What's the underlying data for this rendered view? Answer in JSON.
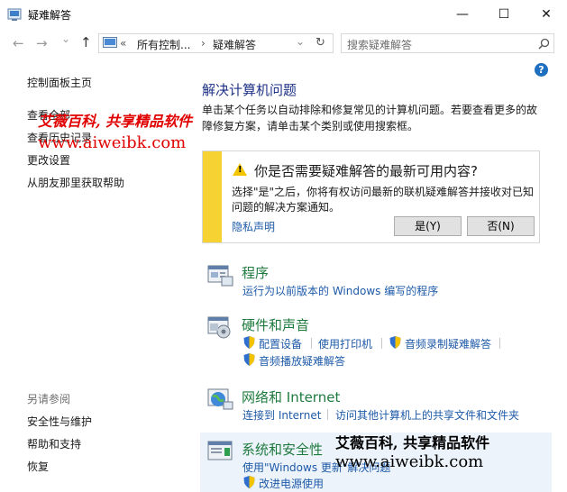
{
  "window": {
    "title": "疑难解答",
    "min": "—",
    "max": "☐",
    "close": "✕"
  },
  "nav": {
    "back": "←",
    "forward": "→",
    "dropdown": "⌄",
    "up": "↑",
    "chev": "«",
    "crumb1": "所有控制...",
    "crumb_sep": "›",
    "crumb2": "疑难解答",
    "refresh": "↻",
    "search_placeholder": "搜索疑难解答"
  },
  "help_icon": "?",
  "left": {
    "home": "控制面板主页",
    "view_all": "查看全部",
    "history": "查看历史记录",
    "settings": "更改设置",
    "friend": "从朋友那里获取帮助",
    "see_also": "另请参阅",
    "security": "安全性与维护",
    "help_support": "帮助和支持",
    "recovery": "恢复"
  },
  "main": {
    "heading": "解决计算机问题",
    "description": "单击某个任务以自动排除和修复常见的计算机问题。若要查看更多的故障修复方案，请单击某个类别或使用搜索框。",
    "notice": {
      "title": "你是否需要疑难解答的最新可用内容?",
      "text": "选择\"是\"之后，你将有权访问最新的联机疑难解答并接收对已知问题的解决方案通知。",
      "privacy": "隐私声明",
      "yes": "是(Y)",
      "no": "否(N)",
      "warn_glyph": "!"
    },
    "categories": [
      {
        "title": "程序",
        "links": [
          "运行为以前版本的 Windows 编写的程序"
        ]
      },
      {
        "title": "硬件和声音",
        "links": [
          "配置设备",
          "使用打印机",
          "音频录制疑难解答",
          "音频播放疑难解答"
        ]
      },
      {
        "title": "网络和 Internet",
        "links": [
          "连接到 Internet",
          "访问其他计算机上的共享文件和文件夹"
        ]
      },
      {
        "title": "系统和安全性",
        "links": [
          "使用\"Windows 更新\"解决问题",
          "改进电源使用"
        ]
      }
    ]
  },
  "watermark": {
    "text1": "艾薇百科, 共享精品软件",
    "url1": "www.aiweibk.com",
    "text2": "艾薇百科, 共享精品软件",
    "url2": "www.aiweibk.com"
  }
}
